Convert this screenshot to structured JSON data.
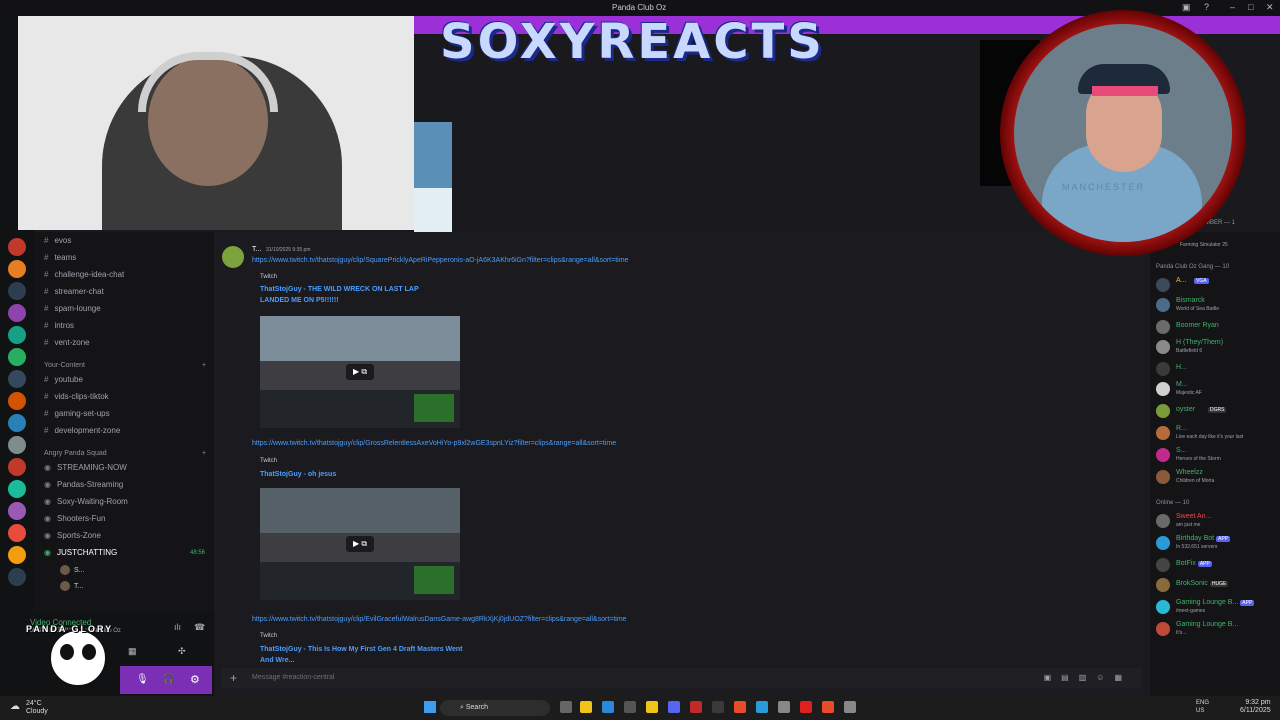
{
  "window": {
    "title": "Panda Club Oz"
  },
  "channels": {
    "items": [
      {
        "label": "evos"
      },
      {
        "label": "teams"
      },
      {
        "label": "challenge-idea-chat"
      },
      {
        "label": "streamer-chat"
      },
      {
        "label": "spam-lounge"
      },
      {
        "label": "intros"
      },
      {
        "label": "vent-zone"
      }
    ],
    "content_category": "Your-Content",
    "content_items": [
      {
        "label": "youtube"
      },
      {
        "label": "vids-clips-tiktok"
      },
      {
        "label": "gaming-set-ups"
      },
      {
        "label": "development-zone"
      }
    ],
    "squad_category": "Angry Panda Squad",
    "voice_items": [
      {
        "label": "STREAMING-NOW"
      },
      {
        "label": "Pandas-Streaming"
      },
      {
        "label": "Soxy-Waiting-Room"
      },
      {
        "label": "Shooters-Fun"
      },
      {
        "label": "Sports-Zone"
      },
      {
        "label": "JUSTCHATTING"
      }
    ],
    "voice_timer": "48:56",
    "voice_users": [
      "S...",
      "T..."
    ]
  },
  "userbar": {
    "status": "Video Connected",
    "sub": "JUSTCHATTING / Panda Club Oz"
  },
  "overlay": {
    "logo": "SOXYREACTS",
    "panda_text": "PANDA GLORY",
    "shirt_text": "MANCHESTER"
  },
  "chat": {
    "author": "T...",
    "timestamp": "31/10/2025 9:35 pm",
    "messages": [
      {
        "url": "https://www.twitch.tv/thatstojguy/clip/SquarePricklyApeRiPepperonis-aO-jA6K3AKhr6iGn?filter=clips&range=all&sort=time",
        "source": "Twitch",
        "title": "ThatStojGuy - THE WILD WRECK ON LAST LAP LANDED ME ON P5!!!!!!"
      },
      {
        "url": "https://www.twitch.tv/thatstojguy/clip/GrossRelentlessAxeVoHiYo-p9xl2wGE3spnLYiz?filter=clips&range=all&sort=time",
        "source": "Twitch",
        "title": "ThatStojGuy - oh jesus"
      },
      {
        "url": "https://www.twitch.tv/thatstojguy/clip/EvilGracefulWalrusDansGame-awg8RkXjKj0jdUOZ?filter=clips&range=all&sort=time",
        "source": "Twitch",
        "title": "ThatStojGuy - This Is How My First Gen 4 Draft Masters Went And Wre..."
      }
    ],
    "placeholder": "Message #reaction-central"
  },
  "members": {
    "header_member": "MEMBER — 1",
    "member_status": "Farming Simulator 25",
    "gang_header": "Panda Club Oz Gang — 10",
    "gang": [
      {
        "name": "A...",
        "status": "VGA",
        "color": "#f0c419"
      },
      {
        "name": "Bismarck",
        "status": "World of Sea Battle",
        "color": "#3fb36b"
      },
      {
        "name": "Boomer Ryan",
        "status": "",
        "color": "#3fb36b"
      },
      {
        "name": "H (They/Them)",
        "status": "Battlefield 6",
        "color": "#3fb36b"
      },
      {
        "name": "H...",
        "status": "",
        "color": "#3fb36b"
      },
      {
        "name": "M...",
        "status": "Majestic AF",
        "color": "#3fb36b"
      },
      {
        "name": "oyster",
        "status": "DGRS",
        "color": "#3fb36b"
      },
      {
        "name": "R...",
        "status": "Live each day like it's your last",
        "color": "#3fb36b"
      },
      {
        "name": "S...",
        "status": "Heroes of the Storm",
        "color": "#3fb36b"
      },
      {
        "name": "Wheelzz",
        "status": "Children of Morta",
        "color": "#3fb36b"
      }
    ],
    "online_header": "Online — 10",
    "online": [
      {
        "name": "Sweet An...",
        "status": "am just me",
        "color": "#e84a4a"
      },
      {
        "name": "Birthday Bot",
        "status": "In 532,651 servers",
        "color": "#3fb36b",
        "badge": "APP"
      },
      {
        "name": "BotFix",
        "status": "",
        "color": "#3fb36b",
        "badge": "APP"
      },
      {
        "name": "BrokSonic",
        "status": "",
        "color": "#3fb36b",
        "badge": "HUGE"
      },
      {
        "name": "Gaming Lounge B...",
        "status": "/meet-games",
        "color": "#3fb36b",
        "badge": "APP"
      },
      {
        "name": "Gaming Lounge B...",
        "status": "It's...",
        "color": "#3fb36b"
      }
    ]
  },
  "taskbar": {
    "weather_temp": "24°C",
    "weather_desc": "Cloudy",
    "search": "Search",
    "lang": "ENG",
    "region": "US",
    "time": "9:32 pm",
    "date": "6/11/2025"
  }
}
